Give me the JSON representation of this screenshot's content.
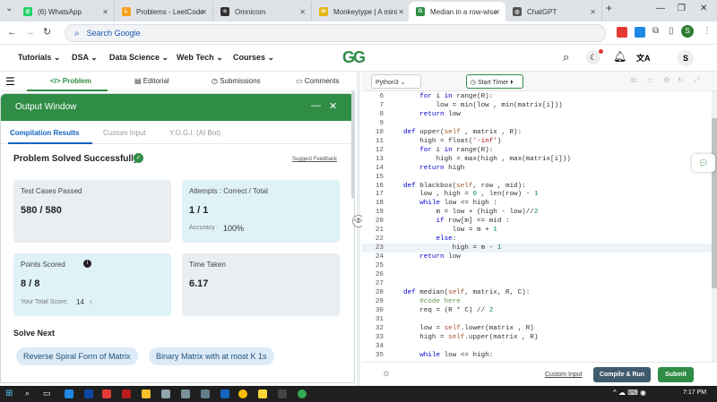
{
  "browser": {
    "tabs": [
      {
        "label": "(6) WhatsApp",
        "color": "#25d366"
      },
      {
        "label": "Problems - LeetCode",
        "color": "#f89f1b"
      },
      {
        "label": "Omnicom",
        "color": "#333333"
      },
      {
        "label": "Monkeytype | A mini",
        "color": "#e2b714"
      },
      {
        "label": "Median in a row-wise",
        "color": "#2f8d46"
      },
      {
        "label": "ChatGPT",
        "color": "#555555"
      }
    ],
    "new_tab": "+",
    "address_placeholder": "Search Google",
    "profile": "S"
  },
  "site": {
    "logo": "GG",
    "nav": [
      "Tutorials",
      "DSA",
      "Data Science",
      "Web Tech",
      "Courses"
    ],
    "avatar": "S"
  },
  "left_tabs": [
    "Problem",
    "Editorial",
    "Submissions",
    "Comments"
  ],
  "output_window": {
    "title": "Output Window",
    "minimize": "—",
    "close": "✕",
    "subtabs": [
      "Compilation Results",
      "Custom Input",
      "Y.O.G.I. (AI Bot)"
    ],
    "status": "Problem Solved Successfully",
    "feedback": "Suggest Feedback",
    "cards": {
      "test_cases_label": "Test Cases Passed",
      "test_cases_value": "580 / 580",
      "attempts_label": "Attempts : Correct / Total",
      "attempts_value": "1 / 1",
      "accuracy_label": "Accuracy :",
      "accuracy_value": "100%",
      "points_label": "Points Scored",
      "points_value": "8 / 8",
      "total_label": "Your Total Score:",
      "total_value": "14",
      "time_label": "Time Taken",
      "time_value": "6.17"
    },
    "solve_next_title": "Solve Next",
    "solve_next": [
      "Reverse Spiral Form of Matrix",
      "Binary Matrix with at most K 1s"
    ]
  },
  "editor": {
    "language": "Python3",
    "start_timer": "Start Timer",
    "lines": [
      {
        "n": "6",
        "text": "    for i in range(R):"
      },
      {
        "n": "7",
        "text": "        low = min(low , min(matrix[i]))"
      },
      {
        "n": "8",
        "text": "    return low"
      },
      {
        "n": "9",
        "text": ""
      },
      {
        "n": "10",
        "text": "def upper(self , matrix , R):"
      },
      {
        "n": "11",
        "text": "    high = float('-inf')"
      },
      {
        "n": "12",
        "text": "    for i in range(R):"
      },
      {
        "n": "13",
        "text": "        high = max(high , max(matrix[i]))"
      },
      {
        "n": "14",
        "text": "    return high"
      },
      {
        "n": "15",
        "text": ""
      },
      {
        "n": "16",
        "text": "def blackbox(self, row , mid):"
      },
      {
        "n": "17",
        "text": "    low , high = 0 , len(row) - 1"
      },
      {
        "n": "18",
        "text": "    while low <= high :"
      },
      {
        "n": "19",
        "text": "        m = low + (high - low)//2"
      },
      {
        "n": "20",
        "text": "        if row[m] <= mid :"
      },
      {
        "n": "21",
        "text": "            low = m + 1"
      },
      {
        "n": "22",
        "text": "        else:"
      },
      {
        "n": "23",
        "text": "            high = m - 1"
      },
      {
        "n": "24",
        "text": "    return low"
      },
      {
        "n": "25",
        "text": ""
      },
      {
        "n": "26",
        "text": ""
      },
      {
        "n": "27",
        "text": ""
      },
      {
        "n": "28",
        "text": "def median(self, matrix, R, C):"
      },
      {
        "n": "29",
        "text": "    #code here"
      },
      {
        "n": "30",
        "text": "    req = (R * C) // 2"
      },
      {
        "n": "31",
        "text": ""
      },
      {
        "n": "32",
        "text": "    low = self.lower(matrix , R)"
      },
      {
        "n": "33",
        "text": "    high = self.upper(matrix , R)"
      },
      {
        "n": "34",
        "text": ""
      },
      {
        "n": "35",
        "text": "    while low <= high:"
      }
    ],
    "custom_input": "Custom Input",
    "compile_run": "Compile & Run",
    "submit": "Submit"
  },
  "taskbar": {
    "time": "7:17 PM"
  }
}
